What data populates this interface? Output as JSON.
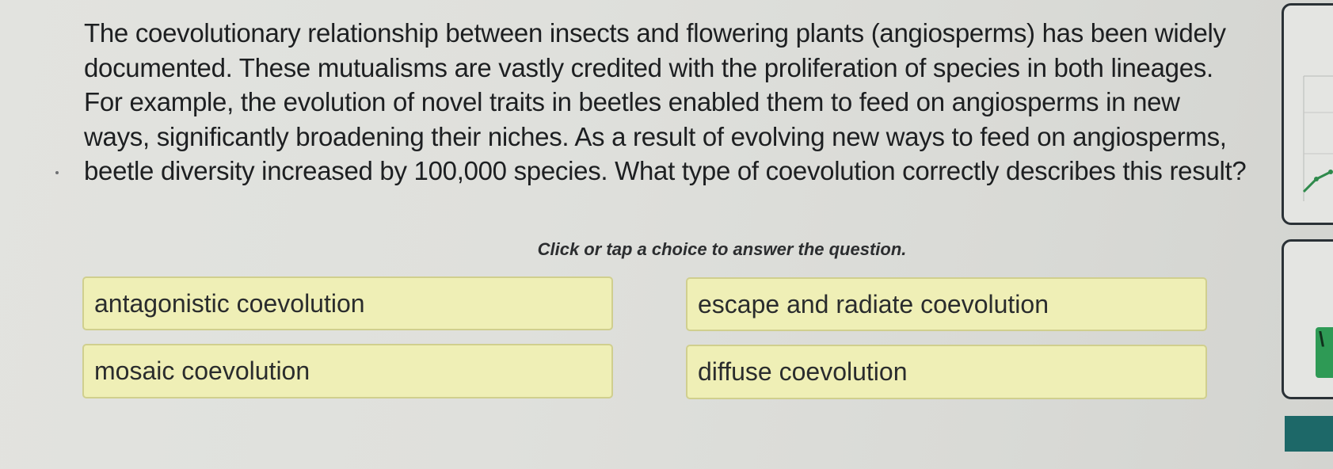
{
  "question": {
    "text": "The coevolutionary relationship between insects and flowering plants (angiosperms) has been widely documented. These mutualisms are vastly credited with the proliferation of species in both lineages. For example, the evolution of novel traits in beetles enabled them to feed on angiosperms in new ways, significantly broadening their niches. As a result of evolving new ways to feed on angiosperms, beetle diversity increased by 100,000 species. What type of coevolution correctly describes this result?"
  },
  "instruction": "Click or tap a choice to answer the question.",
  "choices": [
    {
      "label": "antagonistic coevolution"
    },
    {
      "label": "escape and radiate coevolution"
    },
    {
      "label": "mosaic coevolution"
    },
    {
      "label": "diffuse coevolution"
    }
  ],
  "side": {
    "tab_glyph": "\\",
    "chart_line_color": "#2f8a4c",
    "tab_color": "#2e9a55",
    "bar_color": "#1d6868"
  }
}
